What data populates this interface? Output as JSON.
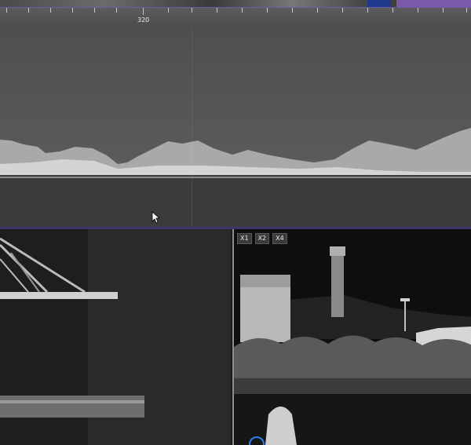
{
  "ruler": {
    "marker_label": "320"
  },
  "zoom_controls": {
    "buttons": [
      {
        "label": "X1"
      },
      {
        "label": "X2"
      },
      {
        "label": "X4"
      }
    ]
  },
  "colors": {
    "accent_blue": "#1f3a8c",
    "accent_purple": "#7a59a8",
    "selection_ring": "#2f7de8"
  },
  "icons": {
    "cursor": "mouse-pointer-icon"
  }
}
